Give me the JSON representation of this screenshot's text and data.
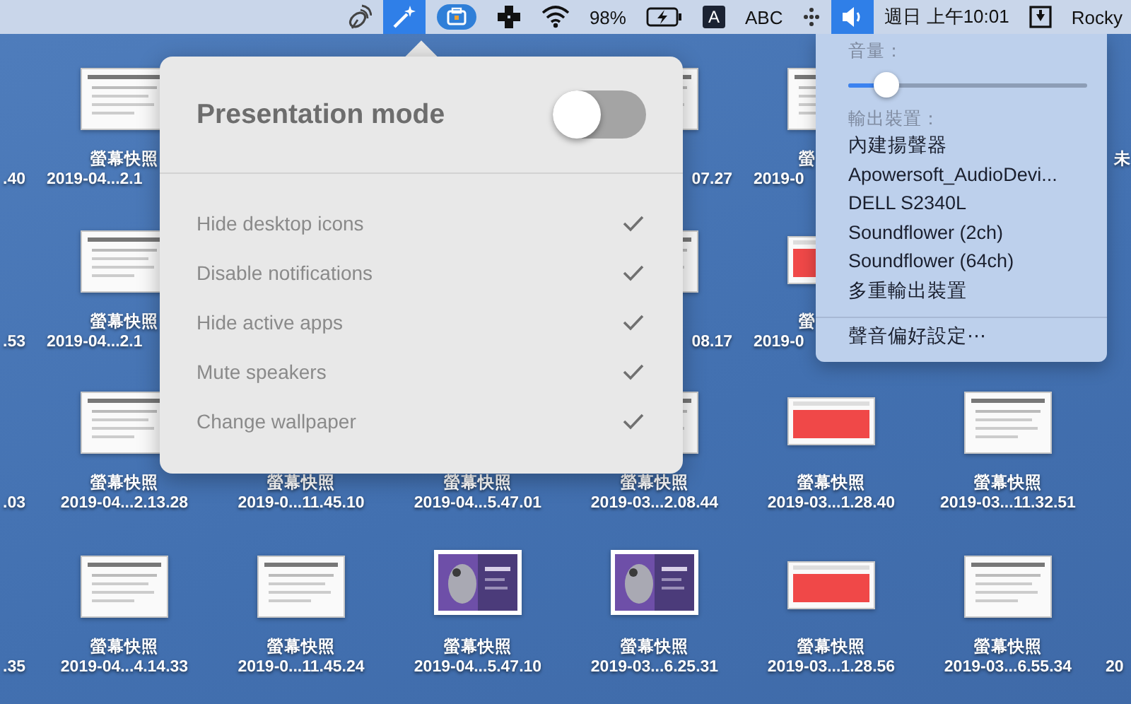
{
  "menu_bar": [
    {
      "kind": "satellite",
      "selected": false
    },
    {
      "kind": "wand",
      "selected": true
    },
    {
      "kind": "toolbox",
      "selected": false
    },
    {
      "kind": "plus",
      "selected": false
    },
    {
      "kind": "wifi",
      "selected": false
    },
    {
      "kind": "text",
      "text": "98%",
      "selected": false
    },
    {
      "kind": "battery",
      "selected": false
    },
    {
      "kind": "keycap",
      "text": "A",
      "selected": false
    },
    {
      "kind": "text",
      "text": "ABC",
      "selected": false
    },
    {
      "kind": "dots",
      "selected": false
    },
    {
      "kind": "speaker",
      "selected": true
    },
    {
      "kind": "text",
      "text": "週日 上午10:01",
      "selected": false
    },
    {
      "kind": "download",
      "selected": false
    },
    {
      "kind": "text",
      "text": "Rocky",
      "selected": false
    }
  ],
  "desktop": {
    "rows": [
      [
        {
          "date": {
            "text": ".40",
            "cut_start": true
          }
        },
        {
          "thumb": {
            "kind": "doc"
          },
          "label": {
            "text": "螢幕快照"
          },
          "date": {
            "text": "2019-04...2.1",
            "cut_end": true
          }
        },
        {},
        {},
        {
          "thumb": {
            "kind": "doc"
          },
          "date": {
            "text": "07.27",
            "cut_start": true
          }
        },
        {
          "thumb": {
            "kind": "doc"
          },
          "label": {
            "text": "螢",
            "cut_end": true
          },
          "date": {
            "text": "2019-0",
            "cut_end": true
          }
        },
        {},
        {
          "label": {
            "text": "未",
            "cut_end": true
          }
        }
      ],
      [
        {
          "date": {
            "text": ".53",
            "cut_start": true
          }
        },
        {
          "thumb": {
            "kind": "doc"
          },
          "label": {
            "text": "螢幕快照"
          },
          "date": {
            "text": "2019-04...2.1",
            "cut_end": true
          }
        },
        {},
        {},
        {
          "thumb": {
            "kind": "doc"
          },
          "date": {
            "text": "08.17",
            "cut_start": true
          }
        },
        {
          "thumb": {
            "kind": "red"
          },
          "label": {
            "text": "螢",
            "cut_end": true
          },
          "date": {
            "text": "2019-0",
            "cut_end": true
          }
        },
        {},
        {}
      ],
      [
        {
          "date": {
            "text": ".03",
            "cut_start": true
          }
        },
        {
          "thumb": {
            "kind": "doc"
          },
          "label": {
            "text": "螢幕快照"
          },
          "date": {
            "text": "2019-04...2.13.28"
          }
        },
        {
          "label": {
            "text": "螢幕快照"
          },
          "date": {
            "text": "2019-0...11.45.10"
          }
        },
        {
          "label": {
            "text": "螢幕快照"
          },
          "date": {
            "text": "2019-04...5.47.01"
          }
        },
        {
          "thumb": {
            "kind": "doc"
          },
          "label": {
            "text": "螢幕快照"
          },
          "date": {
            "text": "2019-03...2.08.44"
          }
        },
        {
          "thumb": {
            "kind": "red"
          },
          "label": {
            "text": "螢幕快照"
          },
          "date": {
            "text": "2019-03...1.28.40"
          }
        },
        {
          "thumb": {
            "kind": "doc"
          },
          "label": {
            "text": "螢幕快照"
          },
          "date": {
            "text": "2019-03...11.32.51"
          }
        },
        {}
      ],
      [
        {
          "date": {
            "text": ".35",
            "cut_start": true
          }
        },
        {
          "thumb": {
            "kind": "doc"
          },
          "label": {
            "text": "螢幕快照"
          },
          "date": {
            "text": "2019-04...4.14.33"
          }
        },
        {
          "thumb": {
            "kind": "doc"
          },
          "label": {
            "text": "螢幕快照"
          },
          "date": {
            "text": "2019-0...11.45.24"
          }
        },
        {
          "label": {
            "text": "螢幕快照"
          },
          "date": {
            "text": "2019-04...5.47.10"
          }
        },
        {
          "label": {
            "text": "螢幕快照"
          },
          "date": {
            "text": "2019-03...6.25.31"
          }
        },
        {
          "thumb": {
            "kind": "red"
          },
          "label": {
            "text": "螢幕快照"
          },
          "date": {
            "text": "2019-03...1.28.56"
          }
        },
        {
          "thumb": {
            "kind": "doc"
          },
          "label": {
            "text": "螢幕快照"
          },
          "date": {
            "text": "2019-03...6.55.34"
          }
        },
        {
          "date": {
            "text": "20",
            "cut_end": true
          }
        }
      ]
    ]
  },
  "presentation_popover": {
    "title": "Presentation mode",
    "on": false,
    "options": [
      {
        "label": "Hide desktop icons",
        "checked": true
      },
      {
        "label": "Disable notifications",
        "checked": true
      },
      {
        "label": "Hide active apps",
        "checked": true
      },
      {
        "label": "Mute speakers",
        "checked": true
      },
      {
        "label": "Change wallpaper",
        "checked": true
      }
    ]
  },
  "sound_menu": {
    "volume_label": "音量：",
    "volume": {
      "level": 0.16
    },
    "output_label": "輸出裝置：",
    "devices": [
      "內建揚聲器",
      "Apowersoft_AudioDevi...",
      "DELL S2340L",
      "Soundflower (2ch)",
      "Soundflower (64ch)",
      "多重輸出裝置"
    ],
    "preferences": "聲音偏好設定⋯"
  }
}
